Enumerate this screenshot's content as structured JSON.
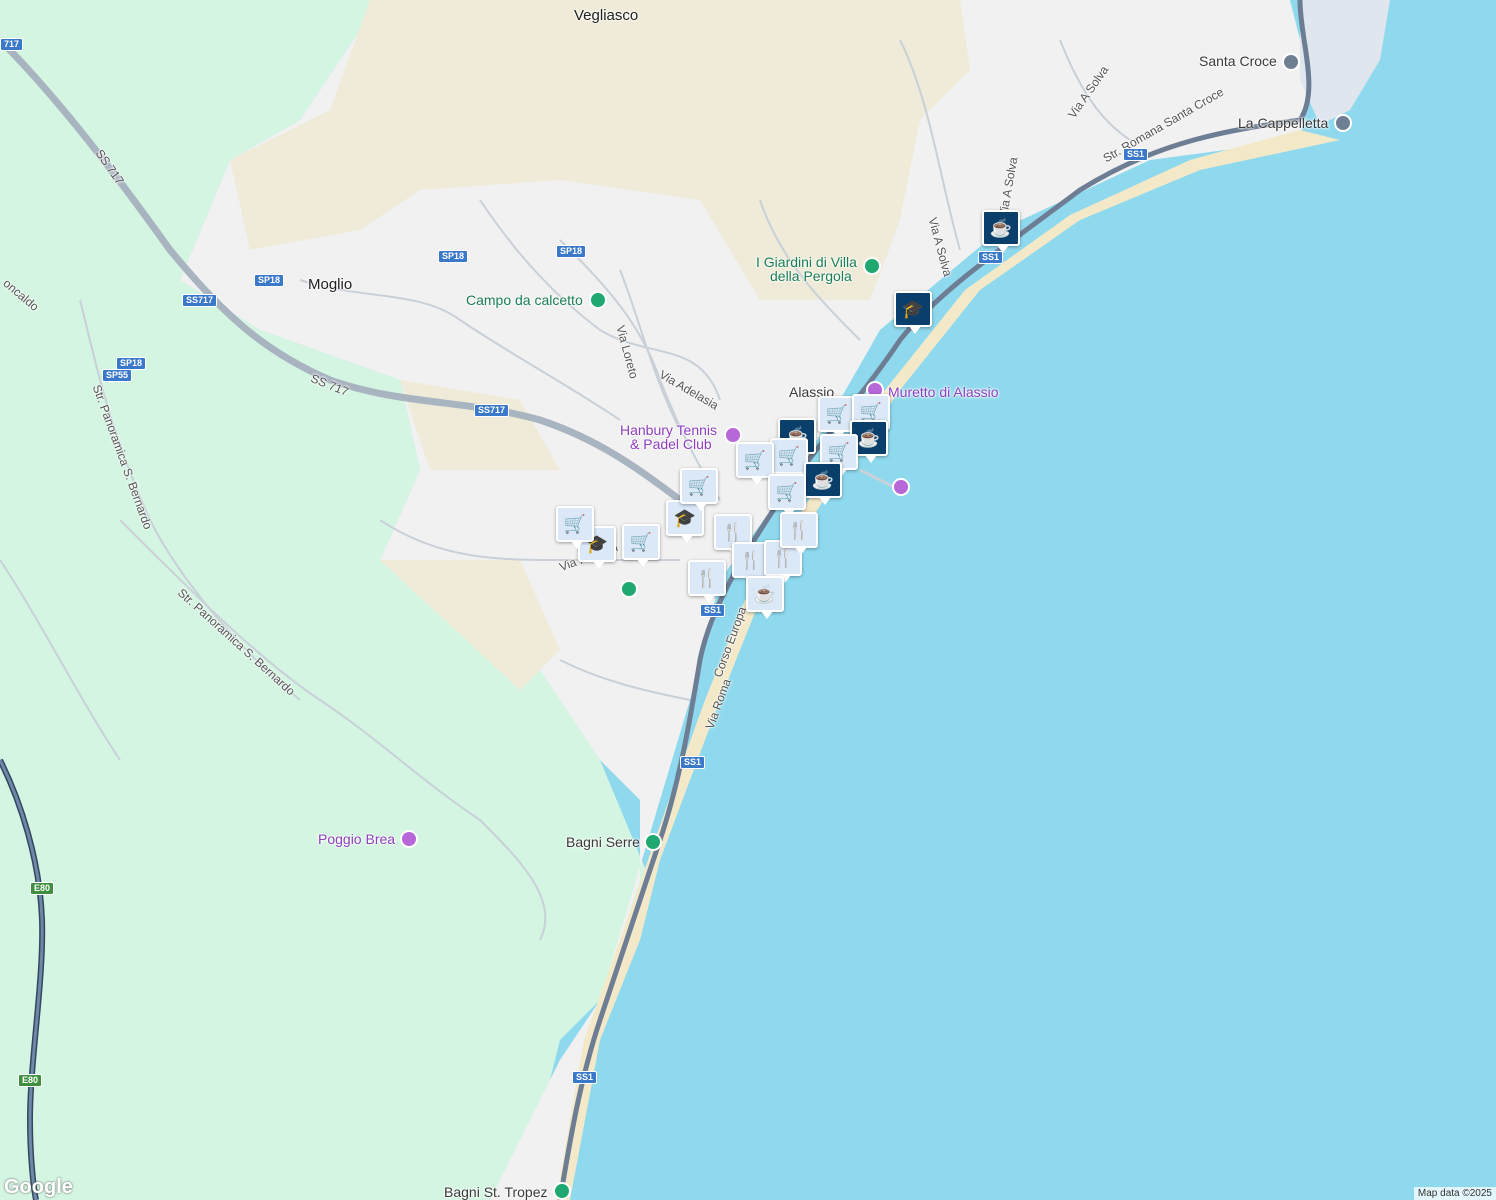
{
  "map": {
    "places": [
      {
        "id": "vegliasco",
        "text": "Vegliasco"
      },
      {
        "id": "santa-croce",
        "text": "Santa Croce"
      },
      {
        "id": "la-cappelletta",
        "text": "La Cappelletta"
      },
      {
        "id": "moglio",
        "text": "Moglio"
      },
      {
        "id": "campo-calcetto",
        "text": "Campo da calcetto"
      },
      {
        "id": "giardini",
        "text": "I Giardini di Villa"
      },
      {
        "id": "giardini2",
        "text": "della Pergola"
      },
      {
        "id": "alassio",
        "text": "Alassio"
      },
      {
        "id": "muretto",
        "text": "Muretto di Alassio"
      },
      {
        "id": "hanbury",
        "text": "Hanbury Tennis"
      },
      {
        "id": "hanbury2",
        "text": "& Padel Club"
      },
      {
        "id": "poggio-brea",
        "text": "Poggio Brea"
      },
      {
        "id": "bagni-serre",
        "text": "Bagni Serre"
      },
      {
        "id": "bagni-st-tropez",
        "text": "Bagni St. Tropez"
      }
    ],
    "roads": [
      {
        "id": "via-solva-1",
        "text": "Via A Solva"
      },
      {
        "id": "via-solva-2",
        "text": "Via A Solva"
      },
      {
        "id": "via-solva-3",
        "text": "Via A Solva"
      },
      {
        "id": "str-romana",
        "text": "Str. Romana Santa Croce"
      },
      {
        "id": "via-loreto",
        "text": "Via Loreto"
      },
      {
        "id": "via-adelasia",
        "text": "Via Adelasia"
      },
      {
        "id": "ss717-label",
        "text": "SS 717"
      },
      {
        "id": "ss717-label2",
        "text": "SS 717"
      },
      {
        "id": "str-panoramica-1",
        "text": "Str. Panoramica S. Bernardo"
      },
      {
        "id": "str-panoramica-2",
        "text": "Str. Panoramica S. Bernardo"
      },
      {
        "id": "corso-europa",
        "text": "Corso Europa"
      },
      {
        "id": "via-roma",
        "text": "Via Roma"
      },
      {
        "id": "via-negrelli",
        "text": "Via Negrelli"
      },
      {
        "id": "moncaldo",
        "text": "oncaldo"
      }
    ],
    "shields": [
      {
        "id": "s-717-top",
        "text": "717"
      },
      {
        "id": "s-ss717-1",
        "text": "SS717"
      },
      {
        "id": "s-ss717-2",
        "text": "SS717"
      },
      {
        "id": "s-sp18-1",
        "text": "SP18"
      },
      {
        "id": "s-sp18-2",
        "text": "SP18"
      },
      {
        "id": "s-sp18-3",
        "text": "SP18"
      },
      {
        "id": "s-sp18-4",
        "text": "SP18"
      },
      {
        "id": "s-sp55",
        "text": "SP55"
      },
      {
        "id": "s-ss1-1",
        "text": "SS1"
      },
      {
        "id": "s-ss1-2",
        "text": "SS1"
      },
      {
        "id": "s-ss1-3",
        "text": "SS1"
      },
      {
        "id": "s-ss1-4",
        "text": "SS1"
      },
      {
        "id": "s-ss1-5",
        "text": "SS1"
      },
      {
        "id": "s-e80-1",
        "text": "E80"
      },
      {
        "id": "s-e80-2",
        "text": "E80"
      }
    ],
    "markers": [
      {
        "type": "cafe",
        "icon": "coffee-cup-icon"
      },
      {
        "type": "school",
        "icon": "graduation-cap-icon"
      },
      {
        "type": "shop",
        "icon": "shopping-cart-icon"
      },
      {
        "type": "shop",
        "icon": "shopping-cart-icon"
      },
      {
        "type": "cafe",
        "icon": "coffee-cup-icon"
      },
      {
        "type": "cafe",
        "icon": "coffee-cup-icon"
      },
      {
        "type": "shop",
        "icon": "shopping-cart-icon"
      },
      {
        "type": "shop",
        "icon": "shopping-cart-icon"
      },
      {
        "type": "cafe",
        "icon": "coffee-cup-icon"
      },
      {
        "type": "shop",
        "icon": "shopping-cart-icon"
      },
      {
        "type": "shop",
        "icon": "shopping-cart-icon"
      },
      {
        "type": "school",
        "icon": "graduation-cap-icon"
      },
      {
        "type": "shop",
        "icon": "shopping-cart-icon"
      },
      {
        "type": "school",
        "icon": "graduation-cap-icon"
      },
      {
        "type": "shop",
        "icon": "shopping-cart-icon"
      },
      {
        "type": "restaurant",
        "icon": "fork-knife-icon"
      },
      {
        "type": "restaurant",
        "icon": "fork-knife-icon"
      },
      {
        "type": "restaurant",
        "icon": "fork-knife-icon"
      },
      {
        "type": "restaurant",
        "icon": "fork-knife-icon"
      },
      {
        "type": "restaurant",
        "icon": "fork-knife-icon"
      },
      {
        "type": "cafe",
        "icon": "coffee-cup-icon"
      }
    ],
    "attribution": "Map data ©2025",
    "logo": "Google",
    "colors": {
      "sea": "#8fd9ee",
      "land": "#f1f1f1",
      "park": "#d4f5e2",
      "hill": "#efebd8",
      "road": "#b9c2cc",
      "major": "#6d7d93",
      "marker": "#0b3f6b"
    }
  }
}
